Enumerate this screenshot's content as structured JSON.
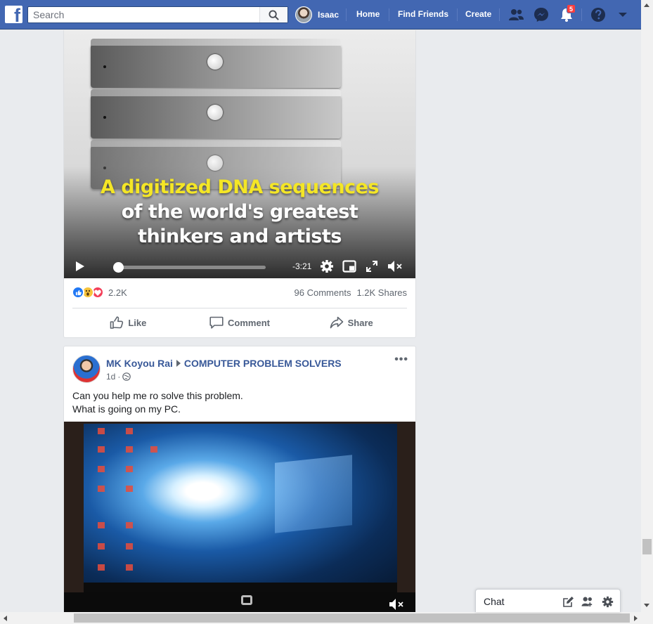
{
  "topbar": {
    "search_placeholder": "Search",
    "profile_name": "Isaac",
    "nav_links": [
      "Home",
      "Find Friends",
      "Create"
    ],
    "notifications_count": "5",
    "brand_color": "#4267b2"
  },
  "video_post": {
    "headline_line1": "A digitized DNA sequences",
    "headline_line2": "of the world's greatest",
    "headline_line3": "thinkers and artists",
    "time_remaining": "-3:21",
    "progress_fraction": 0.03,
    "reactions_count": "2.2K",
    "comments": "96 Comments",
    "shares": "1.2K Shares",
    "actions": {
      "like": "Like",
      "comment": "Comment",
      "share": "Share"
    }
  },
  "group_post": {
    "author": "MK Koyou Rai",
    "group": "COMPUTER PROBLEM SOLVERS",
    "time": "1d",
    "audience_icon": "public-globe-icon",
    "text_line1": "Can you help me ro solve this problem.",
    "text_line2": "What is going on my PC."
  },
  "chat": {
    "label": "Chat"
  }
}
